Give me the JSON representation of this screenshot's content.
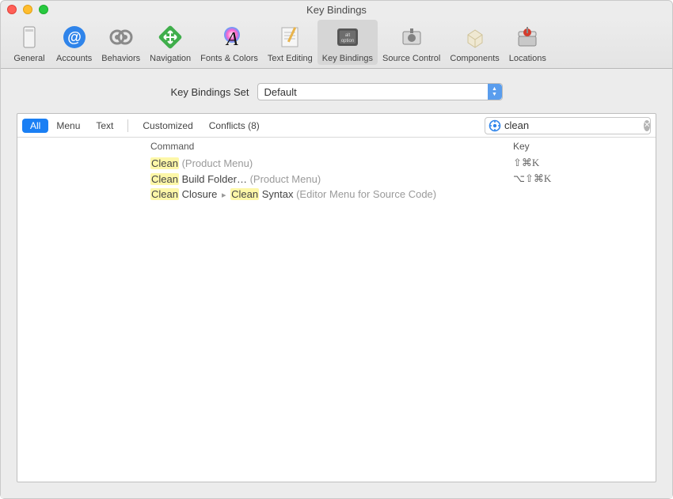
{
  "window": {
    "title": "Key Bindings"
  },
  "toolbar": {
    "items": [
      {
        "label": "General"
      },
      {
        "label": "Accounts"
      },
      {
        "label": "Behaviors"
      },
      {
        "label": "Navigation"
      },
      {
        "label": "Fonts & Colors"
      },
      {
        "label": "Text Editing"
      },
      {
        "label": "Key Bindings"
      },
      {
        "label": "Source Control"
      },
      {
        "label": "Components"
      },
      {
        "label": "Locations"
      }
    ],
    "active_index": 6
  },
  "set_selector": {
    "label": "Key Bindings Set",
    "value": "Default"
  },
  "filter": {
    "segments": {
      "all": "All",
      "menu": "Menu",
      "text": "Text",
      "customized": "Customized",
      "conflicts": "Conflicts (8)"
    },
    "selected": "all",
    "search_value": "clean"
  },
  "columns": {
    "command": "Command",
    "key": "Key"
  },
  "results": [
    {
      "cmd_parts": [
        {
          "text": "Clean",
          "hl": true
        },
        {
          "text": " ",
          "hl": false
        },
        {
          "text": "(Product Menu)",
          "hl": false,
          "dim": true
        }
      ],
      "key": "⇧⌘K"
    },
    {
      "cmd_parts": [
        {
          "text": "Clean",
          "hl": true
        },
        {
          "text": " Build Folder… ",
          "hl": false
        },
        {
          "text": "(Product Menu)",
          "hl": false,
          "dim": true
        }
      ],
      "key": "⌥⇧⌘K"
    },
    {
      "cmd_parts": [
        {
          "text": "Clean",
          "hl": true
        },
        {
          "text": " Closure ",
          "hl": false
        },
        {
          "text": "▸",
          "hl": false,
          "sep": true
        },
        {
          "text": " ",
          "hl": false
        },
        {
          "text": "Clean",
          "hl": true
        },
        {
          "text": " Syntax ",
          "hl": false
        },
        {
          "text": "(Editor Menu for Source Code)",
          "hl": false,
          "dim": true
        }
      ],
      "key": ""
    }
  ]
}
